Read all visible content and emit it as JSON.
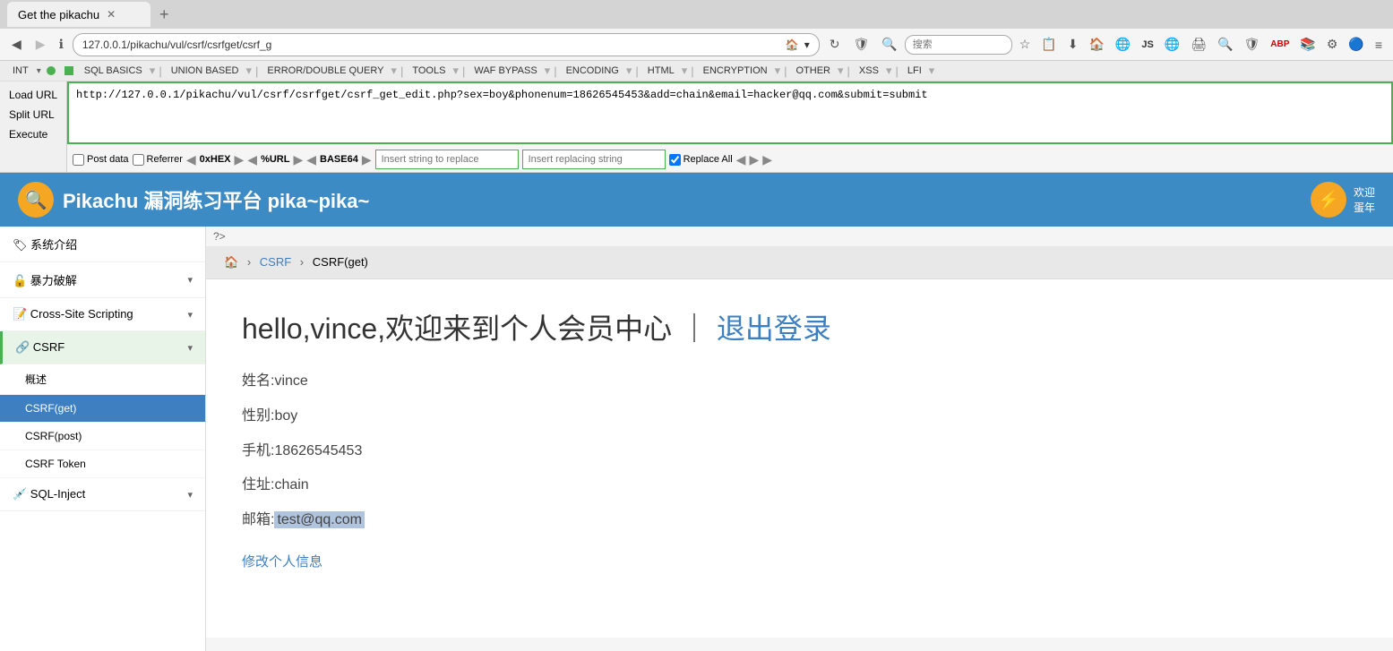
{
  "browser": {
    "tab_title": "Get the pikachu",
    "url": "127.0.0.1/pikachu/vul/csrf/csrfget/csrf_g",
    "full_url": "http://127.0.0.1/pikachu/vul/csrf/csrfget/csrf_get_edit.php?sex=boy&phonenum=18626545453&add=chain&email=hacker@qq.com&submit=submit",
    "search_placeholder": "搜索"
  },
  "hackbar": {
    "menu_items": [
      "INT",
      "SQL BASICS",
      "UNION BASED",
      "ERROR/DOUBLE QUERY",
      "TOOLS",
      "WAF BYPASS",
      "ENCODING",
      "HTML",
      "ENCRYPTION",
      "OTHER",
      "XSS",
      "LFI"
    ],
    "load_url_label": "Load URL",
    "split_url_label": "Split URL",
    "execute_label": "Execute",
    "post_data_label": "Post data",
    "referrer_label": "Referrer",
    "hex_label": "0xHEX",
    "url_label": "%URL",
    "base64_label": "BASE64",
    "insert_replace_placeholder": "Insert string to replace",
    "insert_replacing_placeholder": "Insert replacing string",
    "replace_all_label": "Replace All"
  },
  "pikachu": {
    "title": "Pikachu 漏洞练习平台 pika~pika~",
    "welcome_text": "欢迎",
    "year_text": "蛋年"
  },
  "sidebar": {
    "items": [
      {
        "label": "系统介绍",
        "icon": "🏷"
      },
      {
        "label": "暴力破解",
        "icon": "🔓",
        "expandable": true
      },
      {
        "label": "Cross-Site Scripting",
        "icon": "📝",
        "expandable": true
      },
      {
        "label": "CSRF",
        "icon": "🔗",
        "expandable": true,
        "active": true
      },
      {
        "label": "SQL-Inject",
        "icon": "💉",
        "expandable": true
      }
    ],
    "csrf_subitems": [
      {
        "label": "概述",
        "active": false
      },
      {
        "label": "CSRF(get)",
        "active": true
      },
      {
        "label": "CSRF(post)",
        "active": false
      },
      {
        "label": "CSRF Token",
        "active": false
      }
    ]
  },
  "breadcrumb": {
    "home_icon": "🏠",
    "parent": "CSRF",
    "current": "CSRF(get)"
  },
  "main": {
    "php_notice": "?>",
    "greeting": "hello,vince,欢迎来到个人会员中心 ｜",
    "logout_link": "退出登录",
    "name_label": "姓名:",
    "name_value": "vince",
    "sex_label": "性别:",
    "sex_value": "boy",
    "phone_label": "手机:",
    "phone_value": "18626545453",
    "address_label": "住址:",
    "address_value": "chain",
    "email_label": "邮箱:",
    "email_value": "test@qq.com",
    "modify_link": "修改个人信息"
  }
}
